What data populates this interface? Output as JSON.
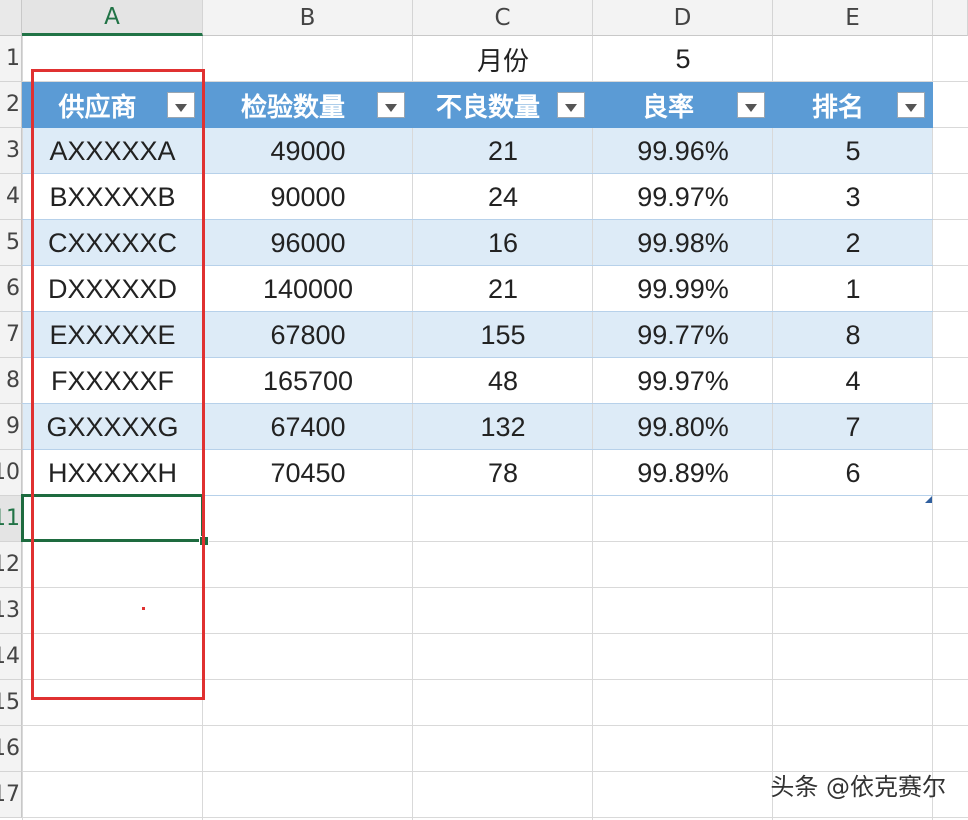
{
  "columns": [
    "A",
    "B",
    "C",
    "D",
    "E"
  ],
  "active_column": "A",
  "row_numbers": [
    "1",
    "2",
    "3",
    "4",
    "5",
    "6",
    "7",
    "8",
    "9",
    "10",
    "11",
    "12",
    "13",
    "14",
    "15",
    "16",
    "17"
  ],
  "active_row": "11",
  "month": {
    "label": "月份",
    "value": "5"
  },
  "table": {
    "headers": [
      "供应商",
      "检验数量",
      "不良数量",
      "良率",
      "排名"
    ],
    "rows": [
      [
        "AXXXXXA",
        "49000",
        "21",
        "99.96%",
        "5"
      ],
      [
        "BXXXXXB",
        "90000",
        "24",
        "99.97%",
        "3"
      ],
      [
        "CXXXXXC",
        "96000",
        "16",
        "99.98%",
        "2"
      ],
      [
        "DXXXXXD",
        "140000",
        "21",
        "99.99%",
        "1"
      ],
      [
        "EXXXXXE",
        "67800",
        "155",
        "99.77%",
        "8"
      ],
      [
        "FXXXXXF",
        "165700",
        "48",
        "99.97%",
        "4"
      ],
      [
        "GXXXXXG",
        "67400",
        "132",
        "99.80%",
        "7"
      ],
      [
        "HXXXXXH",
        "70450",
        "78",
        "99.89%",
        "6"
      ]
    ]
  },
  "colors": {
    "header_blue": "#5b9bd5",
    "band_light": "#ddebf7",
    "selection_green": "#1e6b3f",
    "highlight_red": "#e03131"
  },
  "filter_icon": "dropdown-arrow-icon",
  "watermark": "头条 @依克赛尔"
}
